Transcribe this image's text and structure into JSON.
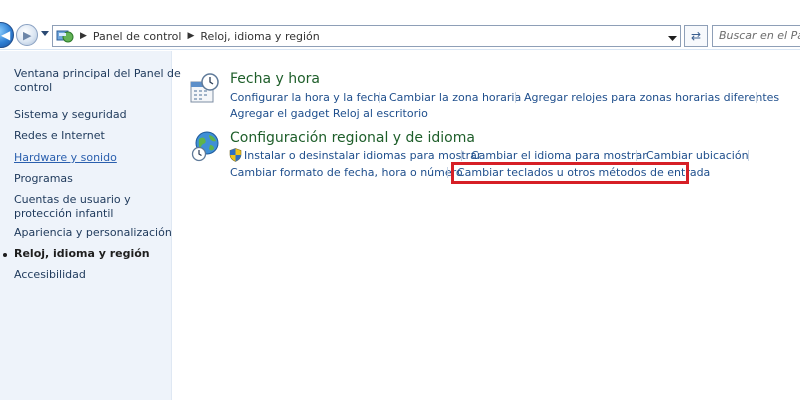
{
  "breadcrumb": {
    "items": [
      "Panel de control",
      "Reloj, idioma y región"
    ]
  },
  "search": {
    "placeholder": "Buscar en el Panel de control"
  },
  "sidebar": {
    "home_line1": "Ventana principal del Panel de",
    "home_line2": "control",
    "items": [
      "Sistema y seguridad",
      "Redes e Internet",
      "Hardware y sonido",
      "Programas",
      "Cuentas de usuario y",
      "protección infantil",
      "Apariencia y personalización",
      "Reloj, idioma y región",
      "Accesibilidad"
    ]
  },
  "sections": {
    "datetime": {
      "title": "Fecha y hora",
      "links": [
        "Configurar la hora y la fecha",
        "Cambiar la zona horaria",
        "Agregar relojes para zonas horarias diferentes",
        "Agregar el gadget Reloj al escritorio"
      ]
    },
    "regional": {
      "title": "Configuración regional y de idioma",
      "links": [
        "Instalar o desinstalar idiomas para mostrar",
        "Cambiar el idioma para mostrar",
        "Cambiar ubicación",
        "Cambiar formato de fecha, hora o número",
        "Cambiar teclados u otros métodos de entrada"
      ]
    }
  },
  "colors": {
    "highlight": "#d61f26",
    "sidebar_bg": "#eef3fa",
    "section_title": "#1e5e2a",
    "link": "#1e4e8c"
  }
}
